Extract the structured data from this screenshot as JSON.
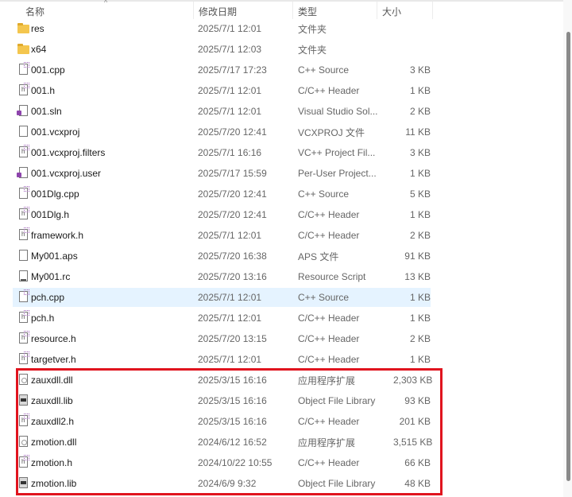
{
  "columns": {
    "name": "名称",
    "date": "修改日期",
    "type": "类型",
    "size": "大小"
  },
  "files": [
    {
      "name": "res",
      "date": "2025/7/1 12:01",
      "type": "文件夹",
      "size": "",
      "icon": "folder"
    },
    {
      "name": "x64",
      "date": "2025/7/1 12:03",
      "type": "文件夹",
      "size": "",
      "icon": "folder"
    },
    {
      "name": "001.cpp",
      "date": "2025/7/17 17:23",
      "type": "C++ Source",
      "size": "3 KB",
      "icon": "cpp"
    },
    {
      "name": "001.h",
      "date": "2025/7/1 12:01",
      "type": "C/C++ Header",
      "size": "1 KB",
      "icon": "h"
    },
    {
      "name": "001.sln",
      "date": "2025/7/1 12:01",
      "type": "Visual Studio Sol...",
      "size": "2 KB",
      "icon": "vs"
    },
    {
      "name": "001.vcxproj",
      "date": "2025/7/20 12:41",
      "type": "VCXPROJ 文件",
      "size": "11 KB",
      "icon": "file"
    },
    {
      "name": "001.vcxproj.filters",
      "date": "2025/7/1 16:16",
      "type": "VC++ Project Fil...",
      "size": "3 KB",
      "icon": "h"
    },
    {
      "name": "001.vcxproj.user",
      "date": "2025/7/17 15:59",
      "type": "Per-User Project...",
      "size": "1 KB",
      "icon": "vs"
    },
    {
      "name": "001Dlg.cpp",
      "date": "2025/7/20 12:41",
      "type": "C++ Source",
      "size": "5 KB",
      "icon": "cpp"
    },
    {
      "name": "001Dlg.h",
      "date": "2025/7/20 12:41",
      "type": "C/C++ Header",
      "size": "1 KB",
      "icon": "h"
    },
    {
      "name": "framework.h",
      "date": "2025/7/1 12:01",
      "type": "C/C++ Header",
      "size": "2 KB",
      "icon": "h"
    },
    {
      "name": "My001.aps",
      "date": "2025/7/20 16:38",
      "type": "APS 文件",
      "size": "91 KB",
      "icon": "file"
    },
    {
      "name": "My001.rc",
      "date": "2025/7/20 13:16",
      "type": "Resource Script",
      "size": "13 KB",
      "icon": "img"
    },
    {
      "name": "pch.cpp",
      "date": "2025/7/1 12:01",
      "type": "C++ Source",
      "size": "1 KB",
      "icon": "cpp"
    },
    {
      "name": "pch.h",
      "date": "2025/7/1 12:01",
      "type": "C/C++ Header",
      "size": "1 KB",
      "icon": "h"
    },
    {
      "name": "resource.h",
      "date": "2025/7/20 13:15",
      "type": "C/C++ Header",
      "size": "2 KB",
      "icon": "h"
    },
    {
      "name": "targetver.h",
      "date": "2025/7/1 12:01",
      "type": "C/C++ Header",
      "size": "1 KB",
      "icon": "h"
    },
    {
      "name": "zauxdll.dll",
      "date": "2025/3/15 16:16",
      "type": "应用程序扩展",
      "size": "2,303 KB",
      "icon": "dll"
    },
    {
      "name": "zauxdll.lib",
      "date": "2025/3/15 16:16",
      "type": "Object File Library",
      "size": "93 KB",
      "icon": "lib"
    },
    {
      "name": "zauxdll2.h",
      "date": "2025/3/15 16:16",
      "type": "C/C++ Header",
      "size": "201 KB",
      "icon": "h"
    },
    {
      "name": "zmotion.dll",
      "date": "2024/6/12 16:52",
      "type": "应用程序扩展",
      "size": "3,515 KB",
      "icon": "dll"
    },
    {
      "name": "zmotion.h",
      "date": "2024/10/22 10:55",
      "type": "C/C++ Header",
      "size": "66 KB",
      "icon": "h"
    },
    {
      "name": "zmotion.lib",
      "date": "2024/6/9 9:32",
      "type": "Object File Library",
      "size": "48 KB",
      "icon": "lib"
    }
  ],
  "hovered_index": 13,
  "highlight_color": "#e0141e"
}
